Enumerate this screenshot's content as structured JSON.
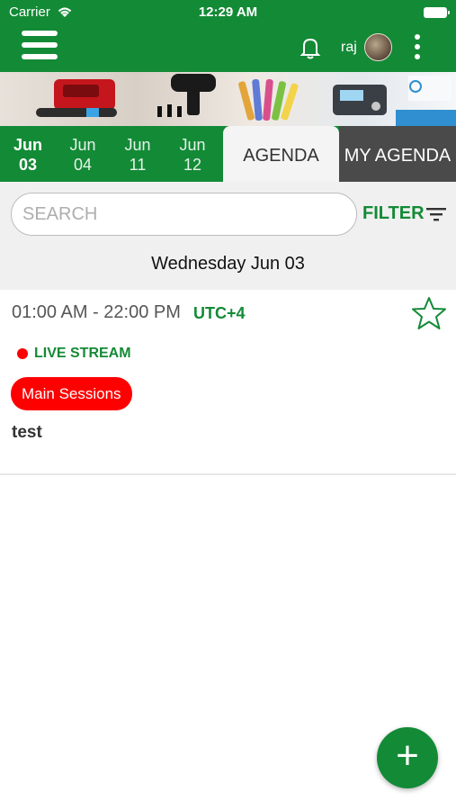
{
  "status_bar": {
    "carrier": "Carrier",
    "time": "12:29 AM"
  },
  "header": {
    "username": "raj"
  },
  "dates": [
    {
      "month": "Jun",
      "day": "03",
      "active": true
    },
    {
      "month": "Jun",
      "day": "04",
      "active": false
    },
    {
      "month": "Jun",
      "day": "11",
      "active": false
    },
    {
      "month": "Jun",
      "day": "12",
      "active": false
    }
  ],
  "tabs": {
    "agenda": "AGENDA",
    "my_agenda": "MY AGENDA"
  },
  "search": {
    "placeholder": "SEARCH",
    "filter_label": "FILTER"
  },
  "day_title": "Wednesday Jun 03",
  "session": {
    "time_range": "01:00 AM - 22:00 PM",
    "timezone": "UTC+4",
    "live_label": "LIVE STREAM",
    "category": "Main Sessions",
    "title": "test"
  },
  "colors": {
    "brand_green": "#138a36",
    "live_red": "#ff0000",
    "dark_tab": "#4a4a4a"
  },
  "icons": [
    "menu-icon",
    "bell-icon",
    "kebab-icon",
    "filter-icon",
    "star-icon",
    "plus-icon"
  ]
}
